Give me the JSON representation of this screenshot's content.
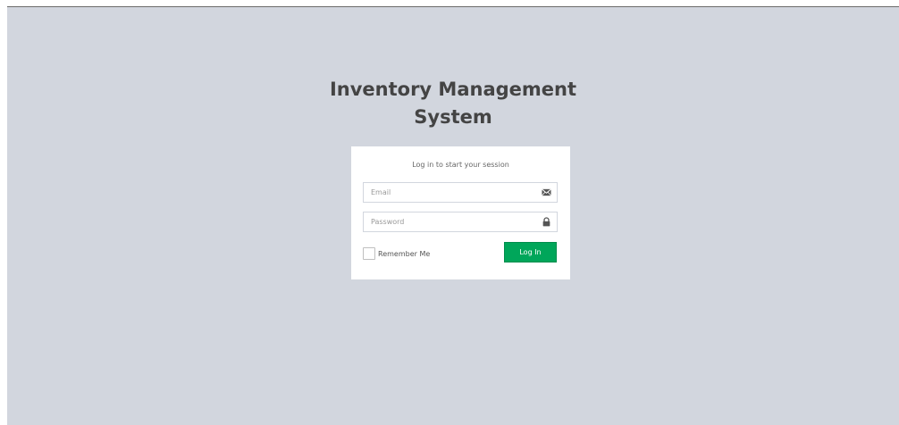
{
  "page": {
    "title_line1": "Inventory Management",
    "title_line2": "System"
  },
  "login": {
    "message": "Log in to start your session",
    "email": {
      "placeholder": "Email",
      "value": "",
      "icon": "envelope-icon"
    },
    "password": {
      "placeholder": "Password",
      "value": "",
      "icon": "lock-icon"
    },
    "remember_label": "Remember Me",
    "remember_checked": false,
    "submit_label": "Log In"
  },
  "colors": {
    "background": "#d2d6de",
    "card": "#ffffff",
    "primary_button": "#00a65a",
    "title_text": "#444444"
  }
}
